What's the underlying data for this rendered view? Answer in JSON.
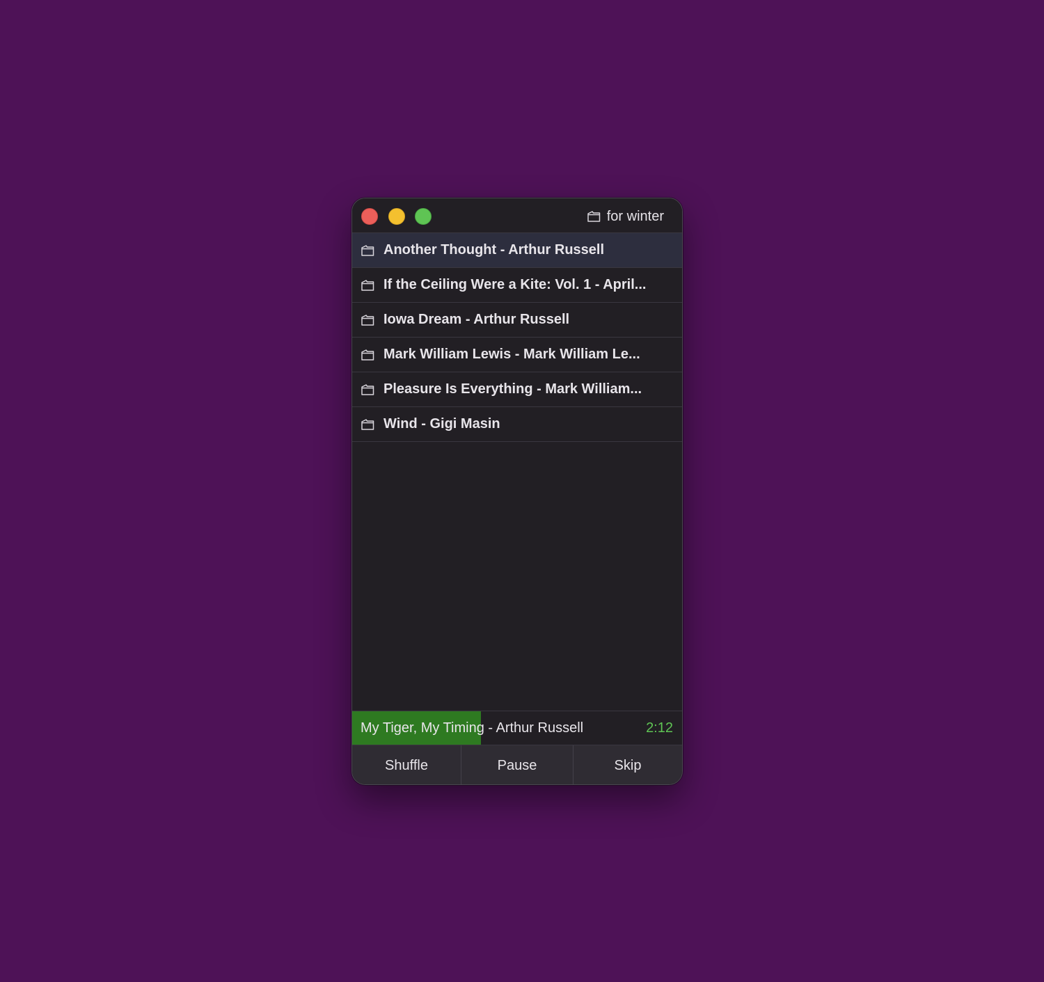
{
  "window": {
    "title": "for winter",
    "title_icon": "folder-icon"
  },
  "playlist": {
    "items": [
      {
        "label": "Another Thought - Arthur Russell",
        "icon": "folder-icon",
        "selected": true
      },
      {
        "label": "If the Ceiling Were a Kite: Vol. 1 - April...",
        "icon": "folder-icon",
        "selected": false
      },
      {
        "label": "Iowa Dream - Arthur Russell",
        "icon": "folder-icon",
        "selected": false
      },
      {
        "label": "Mark William Lewis - Mark William Le...",
        "icon": "folder-icon",
        "selected": false
      },
      {
        "label": "Pleasure Is Everything - Mark William...",
        "icon": "folder-icon",
        "selected": false
      },
      {
        "label": "Wind - Gigi Masin",
        "icon": "folder-icon",
        "selected": false
      }
    ]
  },
  "now_playing": {
    "title": "My Tiger, My Timing - Arthur Russell",
    "time": "2:12",
    "progress_fraction": 0.39
  },
  "controls": {
    "shuffle_label": "Shuffle",
    "pause_label": "Pause",
    "skip_label": "Skip"
  },
  "colors": {
    "background": "#4e1257",
    "window": "#221f24",
    "selected_row": "#2d2e3e",
    "progress": "#2e7a21",
    "time_text": "#5fc454",
    "close": "#ec5f5a",
    "minimize": "#f4c02f",
    "maximize": "#5fc454"
  }
}
